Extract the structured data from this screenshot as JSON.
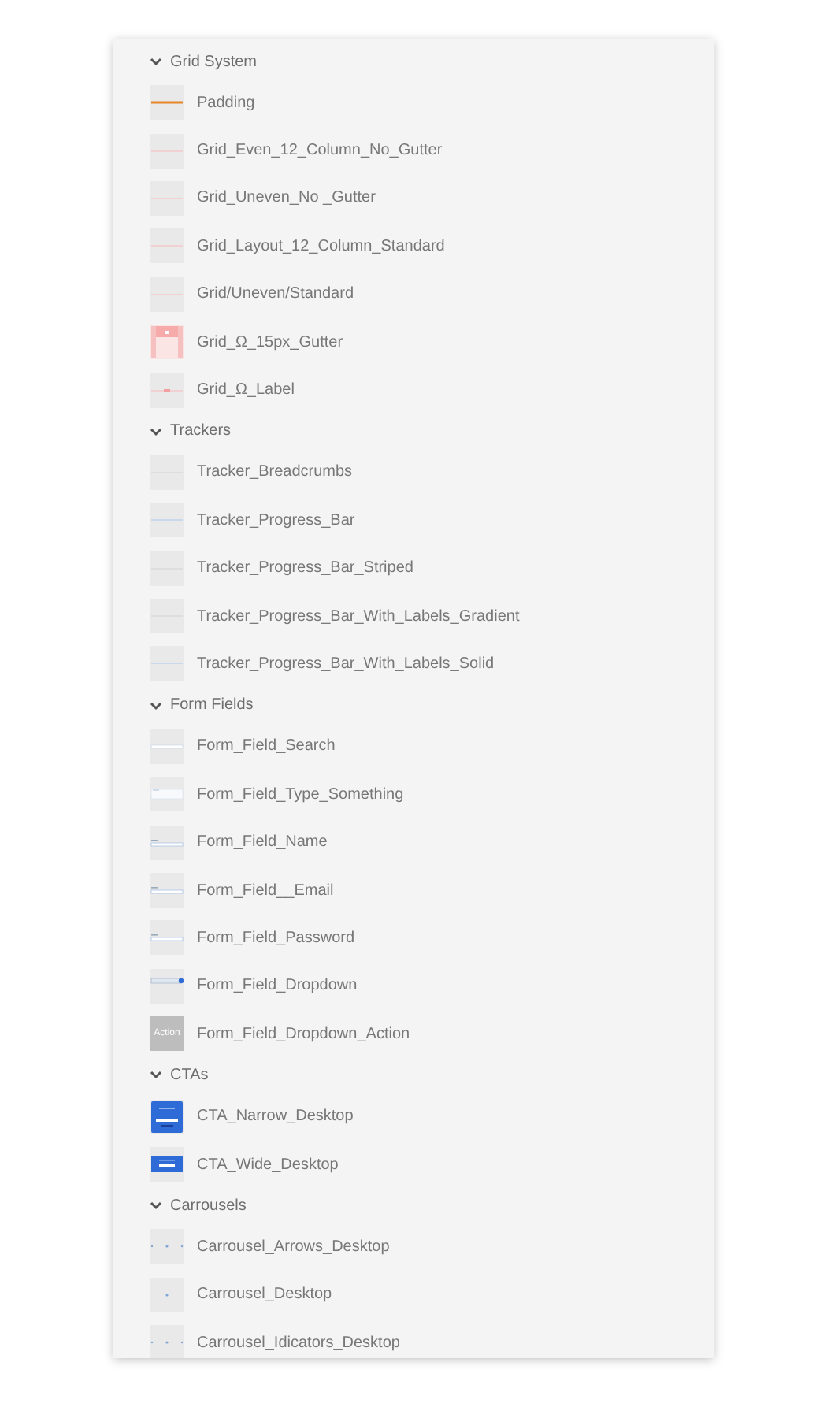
{
  "groups": [
    {
      "title": "Grid System",
      "expanded": true,
      "items": [
        {
          "label": "Padding",
          "kind": "line-orange"
        },
        {
          "label": "Grid_Even_12_Column_No_Gutter",
          "kind": "line-pink"
        },
        {
          "label": "Grid_Uneven_No _Gutter",
          "kind": "line-pink"
        },
        {
          "label": "Grid_Layout_12_Column_Standard",
          "kind": "line-pink"
        },
        {
          "label": "Grid/Uneven/Standard",
          "kind": "line-pink"
        },
        {
          "label": "Grid_Ω_15px_Gutter",
          "kind": "gutter"
        },
        {
          "label": "Grid_Ω_Label",
          "kind": "label"
        }
      ]
    },
    {
      "title": "Trackers",
      "expanded": true,
      "items": [
        {
          "label": "Tracker_Breadcrumbs",
          "kind": "line-grey"
        },
        {
          "label": "Tracker_Progress_Bar",
          "kind": "line-blue"
        },
        {
          "label": "Tracker_Progress_Bar_Striped",
          "kind": "line-grey"
        },
        {
          "label": "Tracker_Progress_Bar_With_Labels_Gradient",
          "kind": "line-grey"
        },
        {
          "label": "Tracker_Progress_Bar_With_Labels_Solid",
          "kind": "line-blue"
        }
      ]
    },
    {
      "title": "Form Fields",
      "expanded": true,
      "items": [
        {
          "label": "Form_Field_Search",
          "kind": "field"
        },
        {
          "label": "Form_Field_Type_Something",
          "kind": "field-wide"
        },
        {
          "label": "Form_Field_Name",
          "kind": "field-label"
        },
        {
          "label": "Form_Field__Email",
          "kind": "field-label"
        },
        {
          "label": "Form_Field_Password",
          "kind": "field-label"
        },
        {
          "label": "Form_Field_Dropdown",
          "kind": "dropdown"
        },
        {
          "label": "Form_Field_Dropdown_Action",
          "kind": "action",
          "thumb_text": "Action"
        }
      ]
    },
    {
      "title": "CTAs",
      "expanded": true,
      "items": [
        {
          "label": "CTA_Narrow_Desktop",
          "kind": "cta-narrow"
        },
        {
          "label": "CTA_Wide_Desktop",
          "kind": "cta-wide"
        }
      ]
    },
    {
      "title": "Carrousels",
      "expanded": true,
      "items": [
        {
          "label": "Carrousel_Arrows_Desktop",
          "kind": "dots3"
        },
        {
          "label": "Carrousel_Desktop",
          "kind": "dots1"
        },
        {
          "label": "Carrousel_Idicators_Desktop",
          "kind": "dots3"
        }
      ]
    }
  ]
}
